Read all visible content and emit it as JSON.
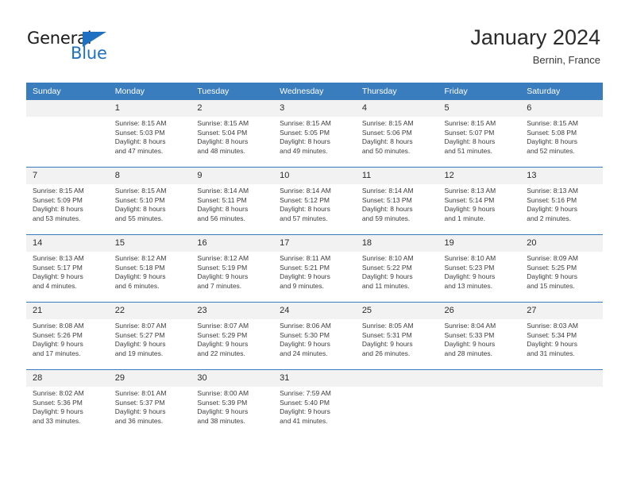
{
  "brand": {
    "name_dark": "General",
    "name_blue": "Blue",
    "accent_color": "#1f70c1"
  },
  "header": {
    "month_title": "January 2024",
    "location": "Bernin, France"
  },
  "theme": {
    "header_bg": "#3a7dbf",
    "daynum_bg": "#f2f2f2",
    "text": "#2b2b2b"
  },
  "calendar": {
    "weekday_headers": [
      "Sunday",
      "Monday",
      "Tuesday",
      "Wednesday",
      "Thursday",
      "Friday",
      "Saturday"
    ],
    "weeks": [
      [
        {
          "day": "",
          "sunrise": "",
          "sunset": "",
          "daylight1": "",
          "daylight2": ""
        },
        {
          "day": "1",
          "sunrise": "Sunrise: 8:15 AM",
          "sunset": "Sunset: 5:03 PM",
          "daylight1": "Daylight: 8 hours",
          "daylight2": "and 47 minutes."
        },
        {
          "day": "2",
          "sunrise": "Sunrise: 8:15 AM",
          "sunset": "Sunset: 5:04 PM",
          "daylight1": "Daylight: 8 hours",
          "daylight2": "and 48 minutes."
        },
        {
          "day": "3",
          "sunrise": "Sunrise: 8:15 AM",
          "sunset": "Sunset: 5:05 PM",
          "daylight1": "Daylight: 8 hours",
          "daylight2": "and 49 minutes."
        },
        {
          "day": "4",
          "sunrise": "Sunrise: 8:15 AM",
          "sunset": "Sunset: 5:06 PM",
          "daylight1": "Daylight: 8 hours",
          "daylight2": "and 50 minutes."
        },
        {
          "day": "5",
          "sunrise": "Sunrise: 8:15 AM",
          "sunset": "Sunset: 5:07 PM",
          "daylight1": "Daylight: 8 hours",
          "daylight2": "and 51 minutes."
        },
        {
          "day": "6",
          "sunrise": "Sunrise: 8:15 AM",
          "sunset": "Sunset: 5:08 PM",
          "daylight1": "Daylight: 8 hours",
          "daylight2": "and 52 minutes."
        }
      ],
      [
        {
          "day": "7",
          "sunrise": "Sunrise: 8:15 AM",
          "sunset": "Sunset: 5:09 PM",
          "daylight1": "Daylight: 8 hours",
          "daylight2": "and 53 minutes."
        },
        {
          "day": "8",
          "sunrise": "Sunrise: 8:15 AM",
          "sunset": "Sunset: 5:10 PM",
          "daylight1": "Daylight: 8 hours",
          "daylight2": "and 55 minutes."
        },
        {
          "day": "9",
          "sunrise": "Sunrise: 8:14 AM",
          "sunset": "Sunset: 5:11 PM",
          "daylight1": "Daylight: 8 hours",
          "daylight2": "and 56 minutes."
        },
        {
          "day": "10",
          "sunrise": "Sunrise: 8:14 AM",
          "sunset": "Sunset: 5:12 PM",
          "daylight1": "Daylight: 8 hours",
          "daylight2": "and 57 minutes."
        },
        {
          "day": "11",
          "sunrise": "Sunrise: 8:14 AM",
          "sunset": "Sunset: 5:13 PM",
          "daylight1": "Daylight: 8 hours",
          "daylight2": "and 59 minutes."
        },
        {
          "day": "12",
          "sunrise": "Sunrise: 8:13 AM",
          "sunset": "Sunset: 5:14 PM",
          "daylight1": "Daylight: 9 hours",
          "daylight2": "and 1 minute."
        },
        {
          "day": "13",
          "sunrise": "Sunrise: 8:13 AM",
          "sunset": "Sunset: 5:16 PM",
          "daylight1": "Daylight: 9 hours",
          "daylight2": "and 2 minutes."
        }
      ],
      [
        {
          "day": "14",
          "sunrise": "Sunrise: 8:13 AM",
          "sunset": "Sunset: 5:17 PM",
          "daylight1": "Daylight: 9 hours",
          "daylight2": "and 4 minutes."
        },
        {
          "day": "15",
          "sunrise": "Sunrise: 8:12 AM",
          "sunset": "Sunset: 5:18 PM",
          "daylight1": "Daylight: 9 hours",
          "daylight2": "and 6 minutes."
        },
        {
          "day": "16",
          "sunrise": "Sunrise: 8:12 AM",
          "sunset": "Sunset: 5:19 PM",
          "daylight1": "Daylight: 9 hours",
          "daylight2": "and 7 minutes."
        },
        {
          "day": "17",
          "sunrise": "Sunrise: 8:11 AM",
          "sunset": "Sunset: 5:21 PM",
          "daylight1": "Daylight: 9 hours",
          "daylight2": "and 9 minutes."
        },
        {
          "day": "18",
          "sunrise": "Sunrise: 8:10 AM",
          "sunset": "Sunset: 5:22 PM",
          "daylight1": "Daylight: 9 hours",
          "daylight2": "and 11 minutes."
        },
        {
          "day": "19",
          "sunrise": "Sunrise: 8:10 AM",
          "sunset": "Sunset: 5:23 PM",
          "daylight1": "Daylight: 9 hours",
          "daylight2": "and 13 minutes."
        },
        {
          "day": "20",
          "sunrise": "Sunrise: 8:09 AM",
          "sunset": "Sunset: 5:25 PM",
          "daylight1": "Daylight: 9 hours",
          "daylight2": "and 15 minutes."
        }
      ],
      [
        {
          "day": "21",
          "sunrise": "Sunrise: 8:08 AM",
          "sunset": "Sunset: 5:26 PM",
          "daylight1": "Daylight: 9 hours",
          "daylight2": "and 17 minutes."
        },
        {
          "day": "22",
          "sunrise": "Sunrise: 8:07 AM",
          "sunset": "Sunset: 5:27 PM",
          "daylight1": "Daylight: 9 hours",
          "daylight2": "and 19 minutes."
        },
        {
          "day": "23",
          "sunrise": "Sunrise: 8:07 AM",
          "sunset": "Sunset: 5:29 PM",
          "daylight1": "Daylight: 9 hours",
          "daylight2": "and 22 minutes."
        },
        {
          "day": "24",
          "sunrise": "Sunrise: 8:06 AM",
          "sunset": "Sunset: 5:30 PM",
          "daylight1": "Daylight: 9 hours",
          "daylight2": "and 24 minutes."
        },
        {
          "day": "25",
          "sunrise": "Sunrise: 8:05 AM",
          "sunset": "Sunset: 5:31 PM",
          "daylight1": "Daylight: 9 hours",
          "daylight2": "and 26 minutes."
        },
        {
          "day": "26",
          "sunrise": "Sunrise: 8:04 AM",
          "sunset": "Sunset: 5:33 PM",
          "daylight1": "Daylight: 9 hours",
          "daylight2": "and 28 minutes."
        },
        {
          "day": "27",
          "sunrise": "Sunrise: 8:03 AM",
          "sunset": "Sunset: 5:34 PM",
          "daylight1": "Daylight: 9 hours",
          "daylight2": "and 31 minutes."
        }
      ],
      [
        {
          "day": "28",
          "sunrise": "Sunrise: 8:02 AM",
          "sunset": "Sunset: 5:36 PM",
          "daylight1": "Daylight: 9 hours",
          "daylight2": "and 33 minutes."
        },
        {
          "day": "29",
          "sunrise": "Sunrise: 8:01 AM",
          "sunset": "Sunset: 5:37 PM",
          "daylight1": "Daylight: 9 hours",
          "daylight2": "and 36 minutes."
        },
        {
          "day": "30",
          "sunrise": "Sunrise: 8:00 AM",
          "sunset": "Sunset: 5:39 PM",
          "daylight1": "Daylight: 9 hours",
          "daylight2": "and 38 minutes."
        },
        {
          "day": "31",
          "sunrise": "Sunrise: 7:59 AM",
          "sunset": "Sunset: 5:40 PM",
          "daylight1": "Daylight: 9 hours",
          "daylight2": "and 41 minutes."
        },
        {
          "day": "",
          "sunrise": "",
          "sunset": "",
          "daylight1": "",
          "daylight2": ""
        },
        {
          "day": "",
          "sunrise": "",
          "sunset": "",
          "daylight1": "",
          "daylight2": ""
        },
        {
          "day": "",
          "sunrise": "",
          "sunset": "",
          "daylight1": "",
          "daylight2": ""
        }
      ]
    ]
  }
}
